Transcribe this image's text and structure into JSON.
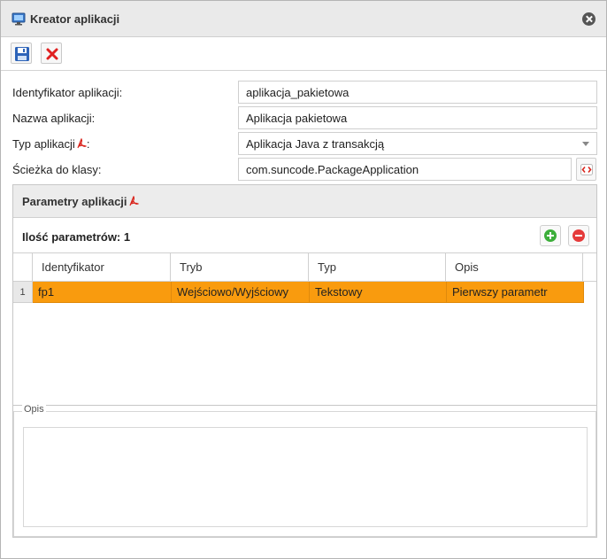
{
  "window": {
    "title": "Kreator aplikacji",
    "icons": {
      "title": "monitor-icon",
      "close": "close-circle-icon"
    }
  },
  "toolbar": {
    "save_icon": "floppy-disk-icon",
    "cancel_icon": "red-x-icon"
  },
  "form": {
    "id_label": "Identyfikator aplikacji:",
    "id_value": "aplikacja_pakietowa",
    "name_label": "Nazwa aplikacji:",
    "name_value": "Aplikacja pakietowa",
    "type_label": "Typ aplikacji",
    "type_label_suffix": ":",
    "type_value": "Aplikacja Java z transakcją",
    "path_label": "Ścieżka do klasy:",
    "path_value": "com.suncode.PackageApplication",
    "path_button_icon": "code-icon"
  },
  "params": {
    "title": "Parametry aplikacji",
    "title_icon": "pdf-icon",
    "count_label": "Ilość parametrów: 1",
    "add_icon": "add-icon",
    "remove_icon": "remove-icon",
    "columns": [
      "Identyfikator",
      "Tryb",
      "Typ",
      "Opis"
    ],
    "rows": [
      {
        "num": "1",
        "id": "fp1",
        "mode": "Wejściowo/Wyjściowy",
        "type": "Tekstowy",
        "desc": "Pierwszy parametr"
      }
    ],
    "selected_row_color": "#f99b0e"
  },
  "description": {
    "legend": "Opis",
    "value": ""
  }
}
